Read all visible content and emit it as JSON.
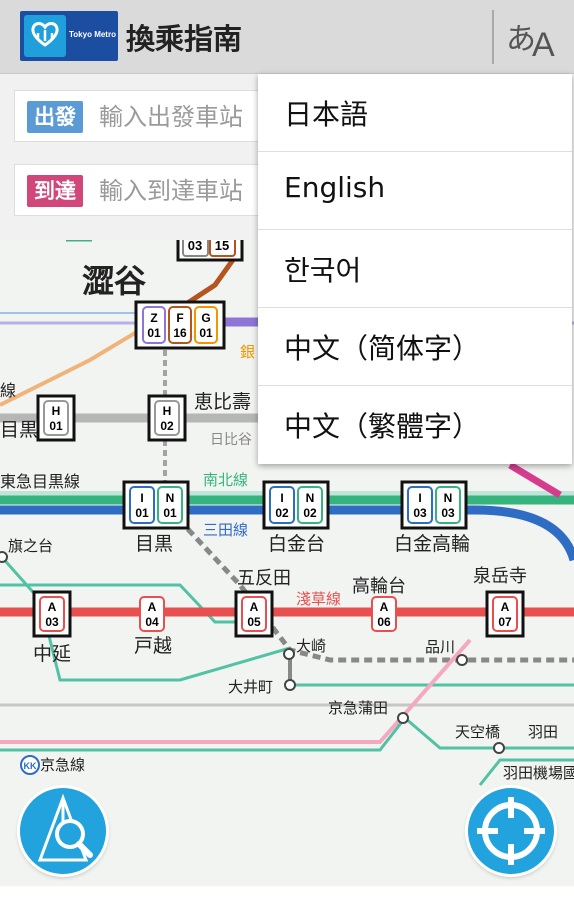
{
  "header": {
    "logo_text": "Tokyo Metro",
    "title": "換乘指南",
    "lang_glyph_1": "あ",
    "lang_glyph_2": "A"
  },
  "search": {
    "from_tag": "出發",
    "from_placeholder": "輸入出發車站",
    "from_color": "#5b9bd5",
    "to_tag": "到達",
    "to_placeholder": "輸入到達車站",
    "to_color": "#d2477a"
  },
  "language_menu": {
    "items": [
      "日本語",
      "English",
      "한국어",
      "中文（简体字）",
      "中文（繁體字）"
    ]
  },
  "map": {
    "stations": {
      "shibuya": "澀谷",
      "ebisu": "恵比壽",
      "meguro": "目黒",
      "shirokanedai": "白金台",
      "shirokane_takanawa": "白金高輪",
      "gotanda": "五反田",
      "takanawadai": "高輪台",
      "sengakuji": "泉岳寺",
      "nakanobu": "中延",
      "togoshi": "戸越",
      "hatanodai": "旗之台",
      "osaki": "大崎",
      "shinagawa": "品川",
      "oimachi": "大井町",
      "keikyu_kamata": "京急蒲田",
      "tenkubashi": "天空橋",
      "haneda_1": "羽田",
      "haneda_2": "羽田機場國",
      "meguro_left": "目黒",
      "ginza_partial": "銀",
      "hibiya_partial": "日比谷"
    },
    "lines": {
      "line_partial": "線",
      "tokyu_meguro": "東急目黒線",
      "namboku": "南北線",
      "mita": "三田線",
      "asakusa": "淺草線",
      "keikyu": "京急線",
      "keikyu_badge": "KK"
    },
    "codes": {
      "shibuya_top": [
        "03",
        "15"
      ],
      "shibuya_letters": [
        "Z",
        "F",
        "G"
      ],
      "shibuya_nums": [
        "01",
        "16",
        "01"
      ],
      "h01": [
        "H",
        "01"
      ],
      "h02": [
        "H",
        "02"
      ],
      "meguro": [
        "I",
        "01",
        "N",
        "01"
      ],
      "shirokanedai": [
        "I",
        "02",
        "N",
        "02"
      ],
      "shirokane_takanawa": [
        "I",
        "03",
        "N",
        "03"
      ],
      "a03": [
        "A",
        "03"
      ],
      "a04": [
        "A",
        "04"
      ],
      "a05": [
        "A",
        "05"
      ],
      "a06": [
        "A",
        "06"
      ],
      "a07": [
        "A",
        "07"
      ]
    },
    "colors": {
      "asakusa": "#e8504f",
      "namboku": "#35b47d",
      "mita": "#2f6dc5",
      "hibiya": "#b6b6b6",
      "ginza": "#f39700",
      "hanzomon": "#8f76d6",
      "fukutoshin": "#9c5e31",
      "chiyoda": "#00bb85",
      "tokyu": "#69c7b4",
      "jr_pink": "#f5a9c0"
    }
  },
  "buttons": {
    "search_map": "search-map-icon",
    "locate": "locate-icon"
  }
}
